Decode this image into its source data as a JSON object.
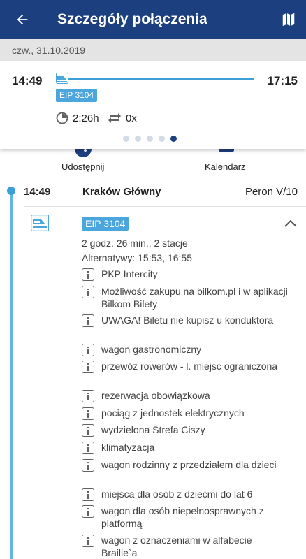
{
  "appbar": {
    "title": "Szczegóły połączenia",
    "back_icon": "arrow-left-icon",
    "map_icon": "map-icon"
  },
  "date": "czw., 31.10.2019",
  "summary": {
    "departure_time": "14:49",
    "arrival_time": "17:15",
    "train_badge": "EIP 3104",
    "duration": "2:26h",
    "transfers": "0x",
    "pager": {
      "count": 5,
      "active": 5
    }
  },
  "actions": {
    "share_label": "Udostępnij",
    "calendar_label": "Kalendarz"
  },
  "stop": {
    "time": "14:49",
    "name": "Kraków Główny",
    "platform": "Peron V/10"
  },
  "train": {
    "badge": "EIP 3104",
    "travel_info": "2 godz. 26 min., 2 stacje",
    "alternatives": "Alternatywy: 15:53, 16:55"
  },
  "notes": [
    {
      "text": "PKP Intercity"
    },
    {
      "text": "Możliwość zakupu na bilkom.pl i w aplikacji Bilkom Bilety"
    },
    {
      "text": "UWAGA! Biletu nie kupisz u konduktora"
    },
    {
      "text": "wagon gastronomiczny"
    },
    {
      "text": "przewóz rowerów - l. miejsc ograniczona"
    },
    {
      "text": "rezerwacja obowiązkowa"
    },
    {
      "text": "pociąg z jednostek elektrycznych"
    },
    {
      "text": "wydzielona Strefa Ciszy"
    },
    {
      "text": "klimatyzacja"
    },
    {
      "text": "wagon rodzinny z przedziałem dla dzieci"
    },
    {
      "text": "miejsca dla osób z dziećmi do lat 6"
    },
    {
      "text": "wagon dla osób niepełnosprawnych z platformą"
    },
    {
      "text": "wagon z oznaczeniami w alfabecie Braille`a"
    }
  ],
  "colors": {
    "appbar": "#1c3f7f",
    "accent": "#4aa6dc",
    "timeline": "#64b5e7"
  }
}
